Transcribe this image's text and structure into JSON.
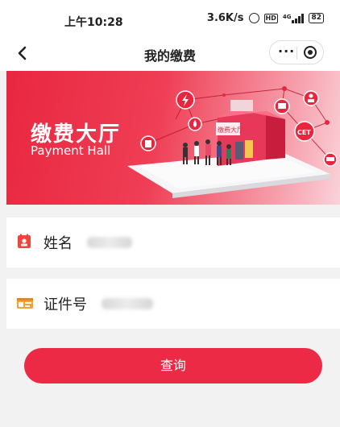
{
  "status_bar": {
    "time": "上午10:28",
    "net_speed": "3.6K/s",
    "battery": "82",
    "network": "4G"
  },
  "nav": {
    "title": "我的缴费",
    "more": "···"
  },
  "banner": {
    "title_cn": "缴费大厅",
    "title_en": "Payment Hall",
    "building_sign": "缴费大厅",
    "badge": "CET"
  },
  "form": {
    "name_label": "姓名",
    "id_label": "证件号"
  },
  "button": {
    "query": "查询"
  },
  "colors": {
    "accent": "#ec2a45",
    "page_bg": "#f2f2f2"
  }
}
